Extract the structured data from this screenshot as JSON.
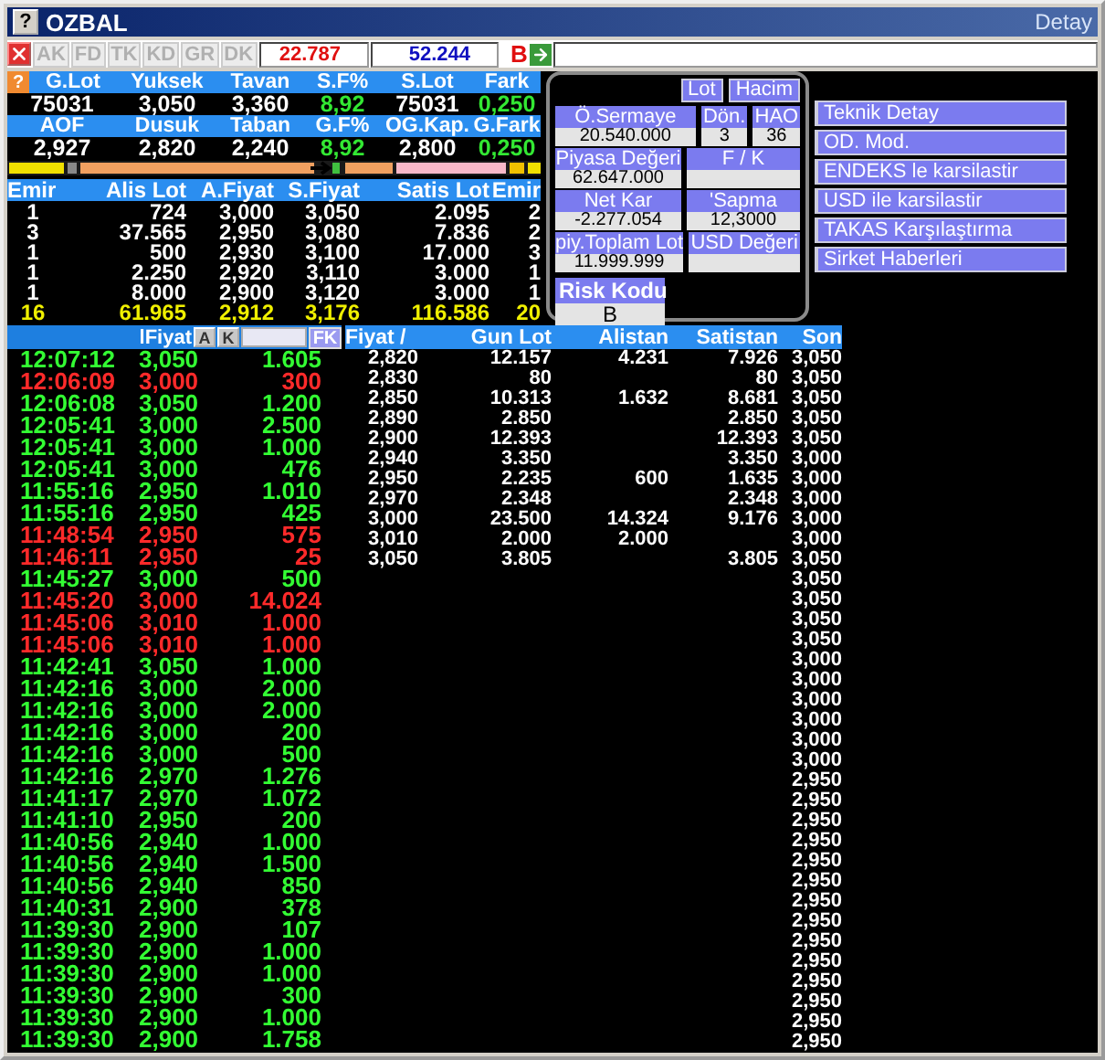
{
  "title_bar": {
    "help_button": "?",
    "title": "OZBAL",
    "detail": "Detay"
  },
  "toolbar": {
    "tabs": [
      {
        "label": "AK",
        "disabled": true
      },
      {
        "label": "FD",
        "disabled": true
      },
      {
        "label": "TK",
        "disabled": true
      },
      {
        "label": "KD",
        "disabled": true
      },
      {
        "label": "GR",
        "disabled": true
      },
      {
        "label": "DK",
        "disabled": true
      }
    ],
    "field_1": "22.787",
    "field_2": "52.244",
    "b_label": "B"
  },
  "summary": {
    "help_button": "?",
    "headers_1": [
      "G.Lot",
      "Yuksek",
      "Tavan",
      "S.F%",
      "S.Lot",
      "Fark"
    ],
    "values_1": [
      "75031",
      "3,050",
      "3,360",
      "8,92",
      "75031",
      "0,250"
    ],
    "headers_2": [
      "AOF",
      "Dusuk",
      "Taban",
      "G.F%",
      "OG.Kap.",
      "G.Fark"
    ],
    "values_2": [
      "2,927",
      "2,820",
      "2,240",
      "8,92",
      "2,800",
      "0,250"
    ]
  },
  "order_book": {
    "columns": [
      "Emir",
      "Alis Lot",
      "A.Fiyat",
      "S.Fiyat",
      "Satis Lot",
      "Emir"
    ],
    "rows": [
      [
        "1",
        "724",
        "3,000",
        "3,050",
        "2.095",
        "2"
      ],
      [
        "3",
        "37.565",
        "2,950",
        "3,080",
        "7.836",
        "2"
      ],
      [
        "1",
        "500",
        "2,930",
        "3,100",
        "17.000",
        "3"
      ],
      [
        "1",
        "2.250",
        "2,920",
        "3,110",
        "3.000",
        "1"
      ],
      [
        "1",
        "8.000",
        "2,900",
        "3,120",
        "3.000",
        "1"
      ]
    ],
    "totals": [
      "16",
      "61.965",
      "2,912",
      "3,176",
      "116.586",
      "20"
    ]
  },
  "info_panel": {
    "buttons": [
      "Lot",
      "Hacim"
    ],
    "rows": [
      [
        {
          "label": "Ö.Sermaye",
          "value": "20.540.000"
        },
        {
          "label": "Dön.",
          "value": "3"
        },
        {
          "label": "HAO",
          "value": "36"
        }
      ],
      [
        {
          "label": "Piyasa Değeri",
          "value": "62.647.000"
        },
        {
          "label": "F / K"
        }
      ],
      [
        {
          "label": "Net Kar",
          "value": "-2.277.054"
        },
        {
          "label": "'Sapma",
          "value": "12,3000"
        }
      ],
      [
        {
          "label": "piy.Toplam Lot",
          "value": "11.999.999"
        },
        {
          "label": "USD Değeri"
        }
      ]
    ],
    "risk": {
      "label": "Risk Kodu",
      "value": "B"
    }
  },
  "links": [
    "Teknik Detay",
    "OD. Mod.",
    "ENDEKS le karsilastir",
    "USD ile karsilastir",
    "TAKAS Karşılaştırma",
    "Sirket Haberleri"
  ],
  "trades": {
    "header": "lFiyat",
    "buttons": [
      "A",
      "K"
    ],
    "filter_button": "FK",
    "rows": [
      {
        "time": "12:07:12",
        "price": "3,050",
        "lot": "1.605",
        "down": false
      },
      {
        "time": "12:06:09",
        "price": "3,000",
        "lot": "300",
        "down": true
      },
      {
        "time": "12:06:08",
        "price": "3,050",
        "lot": "1.200",
        "down": false
      },
      {
        "time": "12:05:41",
        "price": "3,000",
        "lot": "2.500",
        "down": false
      },
      {
        "time": "12:05:41",
        "price": "3,000",
        "lot": "1.000",
        "down": false
      },
      {
        "time": "12:05:41",
        "price": "3,000",
        "lot": "476",
        "down": false
      },
      {
        "time": "11:55:16",
        "price": "2,950",
        "lot": "1.010",
        "down": false
      },
      {
        "time": "11:55:16",
        "price": "2,950",
        "lot": "425",
        "down": false
      },
      {
        "time": "11:48:54",
        "price": "2,950",
        "lot": "575",
        "down": true
      },
      {
        "time": "11:46:11",
        "price": "2,950",
        "lot": "25",
        "down": true
      },
      {
        "time": "11:45:27",
        "price": "3,000",
        "lot": "500",
        "down": false
      },
      {
        "time": "11:45:20",
        "price": "3,000",
        "lot": "14.024",
        "down": true
      },
      {
        "time": "11:45:06",
        "price": "3,010",
        "lot": "1.000",
        "down": true
      },
      {
        "time": "11:45:06",
        "price": "3,010",
        "lot": "1.000",
        "down": true
      },
      {
        "time": "11:42:41",
        "price": "3,050",
        "lot": "1.000",
        "down": false
      },
      {
        "time": "11:42:16",
        "price": "3,000",
        "lot": "2.000",
        "down": false
      },
      {
        "time": "11:42:16",
        "price": "3,000",
        "lot": "2.000",
        "down": false
      },
      {
        "time": "11:42:16",
        "price": "3,000",
        "lot": "200",
        "down": false
      },
      {
        "time": "11:42:16",
        "price": "3,000",
        "lot": "500",
        "down": false
      },
      {
        "time": "11:42:16",
        "price": "2,970",
        "lot": "1.276",
        "down": false
      },
      {
        "time": "11:41:17",
        "price": "2,970",
        "lot": "1.072",
        "down": false
      },
      {
        "time": "11:41:10",
        "price": "2,950",
        "lot": "200",
        "down": false
      },
      {
        "time": "11:40:56",
        "price": "2,940",
        "lot": "1.000",
        "down": false
      },
      {
        "time": "11:40:56",
        "price": "2,940",
        "lot": "1.500",
        "down": false
      },
      {
        "time": "11:40:56",
        "price": "2,940",
        "lot": "850",
        "down": false
      },
      {
        "time": "11:40:31",
        "price": "2,900",
        "lot": "378",
        "down": false
      },
      {
        "time": "11:39:30",
        "price": "2,900",
        "lot": "107",
        "down": false
      },
      {
        "time": "11:39:30",
        "price": "2,900",
        "lot": "1.000",
        "down": false
      },
      {
        "time": "11:39:30",
        "price": "2,900",
        "lot": "1.000",
        "down": false
      },
      {
        "time": "11:39:30",
        "price": "2,900",
        "lot": "300",
        "down": false
      },
      {
        "time": "11:39:30",
        "price": "2,900",
        "lot": "1.000",
        "down": false
      },
      {
        "time": "11:39:30",
        "price": "2,900",
        "lot": "1.758",
        "down": false
      }
    ]
  },
  "price_table": {
    "columns": [
      "Fiyat /",
      "Gun Lot",
      "Alistan",
      "Satistan",
      "Son"
    ],
    "rows": [
      {
        "fiyat": "2,820",
        "gun_lot": "12.157",
        "alistan": "4.231",
        "satistan": "7.926"
      },
      {
        "fiyat": "2,830",
        "gun_lot": "80",
        "satistan": "80"
      },
      {
        "fiyat": "2,850",
        "gun_lot": "10.313",
        "alistan": "1.632",
        "satistan": "8.681"
      },
      {
        "fiyat": "2,890",
        "gun_lot": "2.850",
        "satistan": "2.850"
      },
      {
        "fiyat": "2,900",
        "gun_lot": "12.393",
        "satistan": "12.393"
      },
      {
        "fiyat": "2,940",
        "gun_lot": "3.350",
        "satistan": "3.350"
      },
      {
        "fiyat": "2,950",
        "gun_lot": "2.235",
        "alistan": "600",
        "satistan": "1.635"
      },
      {
        "fiyat": "2,970",
        "gun_lot": "2.348",
        "satistan": "2.348"
      },
      {
        "fiyat": "3,000",
        "gun_lot": "23.500",
        "alistan": "14.324",
        "satistan": "9.176"
      },
      {
        "fiyat": "3,010",
        "gun_lot": "2.000",
        "alistan": "2.000"
      },
      {
        "fiyat": "3,050",
        "gun_lot": "3.805",
        "satistan": "3.805"
      }
    ],
    "son": [
      "3,050",
      "3,050",
      "3,050",
      "3,050",
      "3,050",
      "3,000",
      "3,000",
      "3,000",
      "3,000",
      "3,000",
      "3,050",
      "3,050",
      "3,050",
      "3,050",
      "3,050",
      "3,000",
      "3,000",
      "3,000",
      "3,000",
      "3,000",
      "3,000",
      "2,950",
      "2,950",
      "2,950",
      "2,950",
      "2,950",
      "2,950",
      "2,950",
      "2,950",
      "2,950",
      "2,950",
      "2,950",
      "2,950",
      "2,950",
      "2,950"
    ]
  }
}
